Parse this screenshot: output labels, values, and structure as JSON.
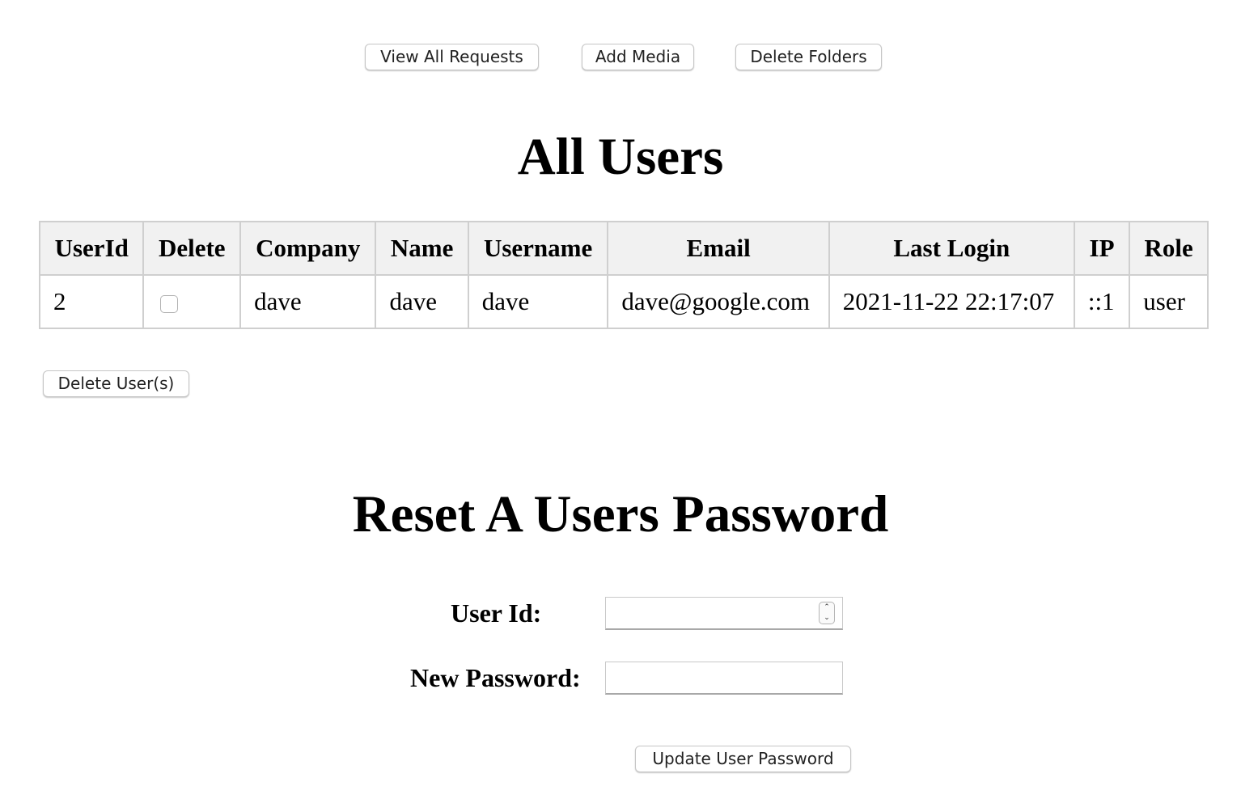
{
  "toolbar": {
    "view_all_requests": "View All Requests",
    "add_media": "Add Media",
    "delete_folders": "Delete Folders"
  },
  "users_section": {
    "title": "All Users",
    "columns": [
      "UserId",
      "Delete",
      "Company",
      "Name",
      "Username",
      "Email",
      "Last Login",
      "IP",
      "Role"
    ],
    "rows": [
      {
        "user_id": "2",
        "delete_checked": false,
        "company": "dave",
        "name": "dave",
        "username": "dave",
        "email": "dave@google.com",
        "last_login": "2021-11-22 22:17:07",
        "ip": "::1",
        "role": "user"
      }
    ],
    "delete_button": "Delete User(s)"
  },
  "reset_section": {
    "title": "Reset A Users Password",
    "user_id_label": "User Id:",
    "user_id_value": "",
    "new_password_label": "New Password:",
    "new_password_value": "",
    "submit_button": "Update User Password"
  },
  "icons": {
    "stepper_up": "chevron-up-icon",
    "stepper_down": "chevron-down-icon"
  }
}
